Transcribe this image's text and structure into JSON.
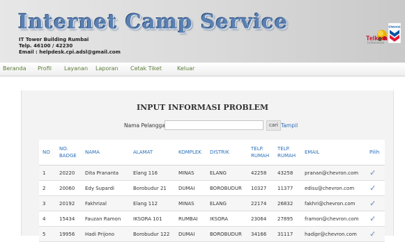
{
  "header": {
    "title": "Internet Camp Service",
    "info_lines": [
      "IT Tower Building Rumbai",
      "Telp. 46100 / 42230",
      "Email : helpdesk.cpi.adsl@gmail.com"
    ],
    "partner_logo": "Telkom Indonesia",
    "partner_logo_sub": "Indonesia",
    "company_logo": "Chevron"
  },
  "nav": {
    "items": [
      "Beranda",
      "Profil",
      "Layanan",
      "Laporan",
      "Cetak Tiket",
      "Keluar"
    ]
  },
  "page": {
    "title": "INPUT INFORMASI PROBLEM",
    "search_label": "Nama Pelanggan",
    "search_value": "",
    "search_button": "cari",
    "show_link": "Tampil"
  },
  "table": {
    "headers": [
      "NO",
      "NO. BADGE",
      "NAMA",
      "ALAMAT",
      "KOMPLEK",
      "DISTRIK",
      "TELP. RUMAH",
      "TELP. RUMAH",
      "EMAIL",
      "Pilih"
    ],
    "rows": [
      [
        "1",
        "20220",
        "Dita Prananta",
        "Elang 116",
        "MINAS",
        "ELANG",
        "42258",
        "43258",
        "pranan@chevron.com"
      ],
      [
        "2",
        "20060",
        "Edy Supardi",
        "Borobudur 21",
        "DUMAI",
        "BOROBUDUR",
        "10327",
        "11377",
        "edisu@chevron.com"
      ],
      [
        "3",
        "20192",
        "Fakhrizal",
        "Elang 112",
        "MINAS",
        "ELANG",
        "22174",
        "26832",
        "fakhri@chevron.com"
      ],
      [
        "4",
        "15434",
        "Fauzan Ramon",
        "IKSORA 101",
        "RUMBAI",
        "IKSORA",
        "23064",
        "27895",
        "framon@chevron.com"
      ],
      [
        "5",
        "19956",
        "Hadi Prijono",
        "Borobudur 122",
        "DUMAI",
        "BOROBUDUR",
        "34166",
        "31117",
        "hadipr@chevron.com"
      ]
    ]
  },
  "colors": {
    "title_blue": "#5b80b1",
    "nav_green": "#5d7c3a",
    "header_blue": "#2a6fb8",
    "telkom_red": "#c8102e",
    "chevron_blue": "#0054a4",
    "chevron_red": "#e31937"
  },
  "icons": {
    "select": "checkmark-icon"
  }
}
